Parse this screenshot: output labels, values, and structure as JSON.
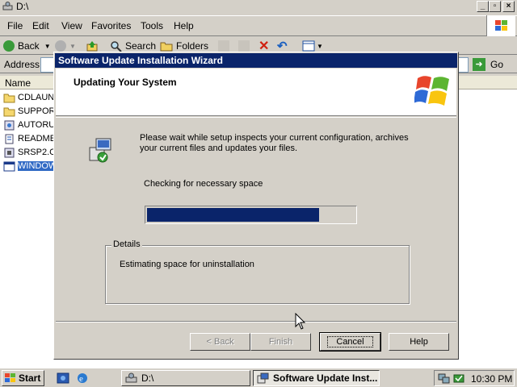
{
  "explorer": {
    "title": "D:\\",
    "menu": [
      "File",
      "Edit",
      "View",
      "Favorites",
      "Tools",
      "Help"
    ],
    "toolbar": {
      "back": "Back",
      "search": "Search",
      "folders": "Folders"
    },
    "address_label": "Address",
    "go_label": "Go",
    "column_name": "Name",
    "files": [
      {
        "name": "CDLAUNC",
        "icon": "folder-icon"
      },
      {
        "name": "SUPPORT",
        "icon": "folder-icon"
      },
      {
        "name": "AUTORU",
        "icon": "setup-icon"
      },
      {
        "name": "READMES",
        "icon": "document-icon"
      },
      {
        "name": "SRSP2.C",
        "icon": "setup-icon"
      },
      {
        "name": "WINDOW",
        "icon": "window-icon",
        "selected": true
      }
    ]
  },
  "wizard": {
    "title": "Software Update Installation Wizard",
    "header": "Updating Your System",
    "intro": "Please wait while setup inspects your current configuration, archives your current files and updates your files.",
    "status": "Checking for necessary space",
    "progress": 0.83,
    "details_label": "Details",
    "details_text": "Estimating space for uninstallation",
    "buttons": {
      "back": "< Back",
      "finish": "Finish",
      "cancel": "Cancel",
      "help": "Help"
    }
  },
  "taskbar": {
    "start": "Start",
    "tasks": [
      {
        "label": "D:\\",
        "active": false
      },
      {
        "label": "Software Update Inst...",
        "active": true
      }
    ],
    "clock": "10:30 PM"
  },
  "colors": {
    "titlebar": "#0a246a",
    "face": "#d4d0c8",
    "selection": "#316ac5"
  }
}
